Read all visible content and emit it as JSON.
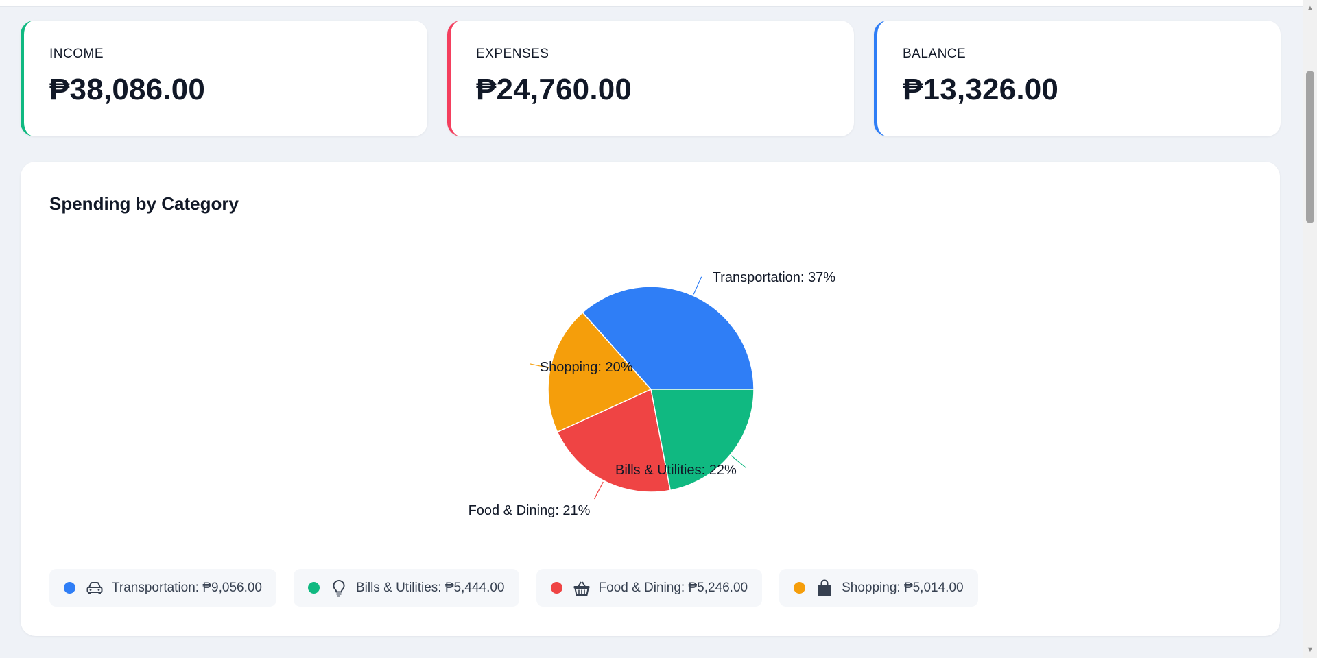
{
  "summary": {
    "income": {
      "label": "INCOME",
      "value": "₱38,086.00",
      "accent": "#10b981"
    },
    "expenses": {
      "label": "EXPENSES",
      "value": "₱24,760.00",
      "accent": "#f43f5e"
    },
    "balance": {
      "label": "BALANCE",
      "value": "₱13,326.00",
      "accent": "#2f7ef6"
    }
  },
  "chart": {
    "title": "Spending by Category"
  },
  "chart_data": {
    "type": "pie",
    "slices": [
      {
        "name": "Transportation",
        "value": 9056,
        "percent_label": "Transportation: 37%",
        "color": "#2f7ef6"
      },
      {
        "name": "Shopping",
        "value": 5014,
        "percent_label": "Shopping: 20%",
        "color": "#f59e0b"
      },
      {
        "name": "Food & Dining",
        "value": 5246,
        "percent_label": "Food & Dining: 21%",
        "color": "#ef4444"
      },
      {
        "name": "Bills & Utilities",
        "value": 5444,
        "percent_label": "Bills & Utilities: 22%",
        "color": "#10b981"
      }
    ]
  },
  "legend": {
    "items": [
      {
        "text": "Transportation: ₱9,056.00",
        "color": "#2f7ef6",
        "icon": "car-icon"
      },
      {
        "text": "Bills & Utilities: ₱5,444.00",
        "color": "#10b981",
        "icon": "lightbulb-icon"
      },
      {
        "text": "Food & Dining: ₱5,246.00",
        "color": "#ef4444",
        "icon": "basket-icon"
      },
      {
        "text": "Shopping: ₱5,014.00",
        "color": "#f59e0b",
        "icon": "shopping-bag-icon"
      }
    ]
  }
}
